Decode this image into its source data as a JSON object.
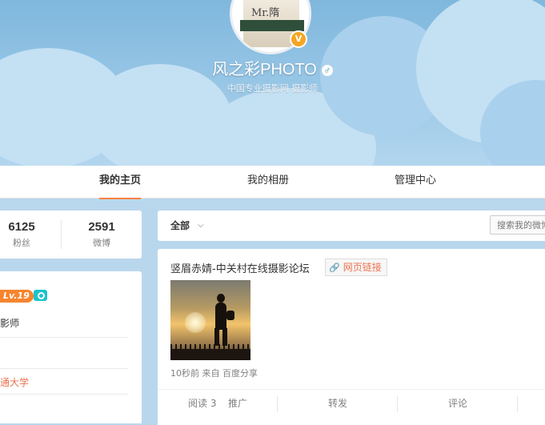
{
  "profile": {
    "nickname": "风之彩PHOTO",
    "gender_symbol": "♂",
    "description": "中国专业摄影网 摄影师",
    "avatar_text": "Mr.隋",
    "verified_symbol": "V"
  },
  "tabs": [
    {
      "label": "我的主页",
      "active": true
    },
    {
      "label": "我的相册",
      "active": false
    },
    {
      "label": "管理中心",
      "active": false
    }
  ],
  "stats": [
    {
      "value": "6125",
      "label": "粉丝"
    },
    {
      "value": "2591",
      "label": "微博"
    }
  ],
  "info": {
    "level": "Lv.19",
    "title_fragment": "影师",
    "school_fragment": "通大学"
  },
  "feed": {
    "filter_label": "全部",
    "chevron": "⌵",
    "search_placeholder": "搜索我的微博"
  },
  "post": {
    "title": "竖眉赤婧-中关村在线摄影论坛",
    "link_label": "网页链接",
    "meta": "10秒前 来自 百度分享",
    "actions": {
      "read": "阅读 3",
      "promote": "推广",
      "repost": "转发",
      "comment": "评论"
    }
  },
  "colors": {
    "accent": "#ff8140",
    "link": "#eb7350",
    "level_badge": "#f7852e",
    "camera_badge": "#1cc3cb",
    "verified": "#f6a623"
  }
}
